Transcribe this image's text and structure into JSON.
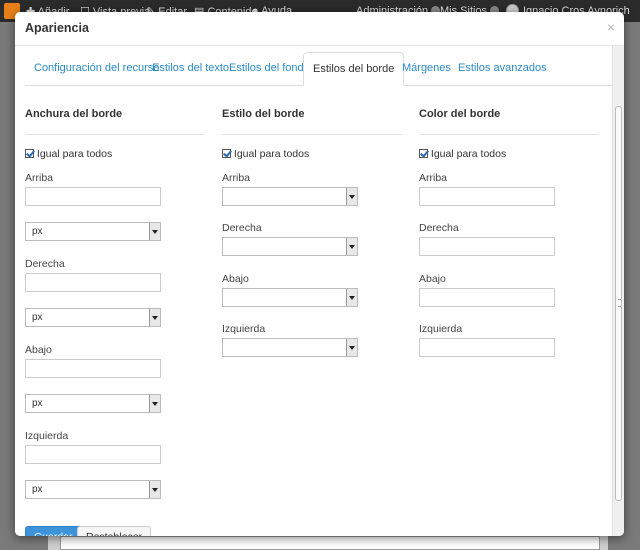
{
  "topbar": {
    "items": [
      "Añadir",
      "Vista previa",
      "Editar",
      "Contenido",
      "Ayuda",
      "Administración",
      "Mis Sitios",
      "Ignacio Cros Aynorich"
    ]
  },
  "dialog": {
    "title": "Apariencia",
    "close": "×",
    "tabs": [
      "Configuración del recurso",
      "Estilos del texto",
      "Estilos del fondo",
      "Estilos del borde",
      "Márgenes",
      "Estilos avanzados"
    ],
    "active_tab": "Estilos del borde"
  },
  "width_column": {
    "title": "Anchura del borde",
    "same_for_all": "Igual para todos",
    "fields": [
      {
        "label": "Arriba",
        "value": "",
        "unit": "px"
      },
      {
        "label": "Derecha",
        "value": "",
        "unit": "px"
      },
      {
        "label": "Abajo",
        "value": "",
        "unit": "px"
      },
      {
        "label": "Izquierda",
        "value": "",
        "unit": "px"
      }
    ]
  },
  "style_column": {
    "title": "Estilo del borde",
    "same_for_all": "Igual para todos",
    "fields": [
      {
        "label": "Arriba",
        "value": ""
      },
      {
        "label": "Derecha",
        "value": ""
      },
      {
        "label": "Abajo",
        "value": ""
      },
      {
        "label": "Izquierda",
        "value": ""
      }
    ]
  },
  "color_column": {
    "title": "Color del borde",
    "same_for_all": "Igual para todos",
    "fields": [
      {
        "label": "Arriba",
        "value": ""
      },
      {
        "label": "Derecha",
        "value": ""
      },
      {
        "label": "Abajo",
        "value": ""
      },
      {
        "label": "Izquierda",
        "value": ""
      }
    ]
  },
  "footer": {
    "save": "Guardar",
    "reset": "Restablecer"
  },
  "colors": {
    "link": "#2a8ac4",
    "primary_button": "#3d94db",
    "toolbar": "#2b2b2b"
  }
}
